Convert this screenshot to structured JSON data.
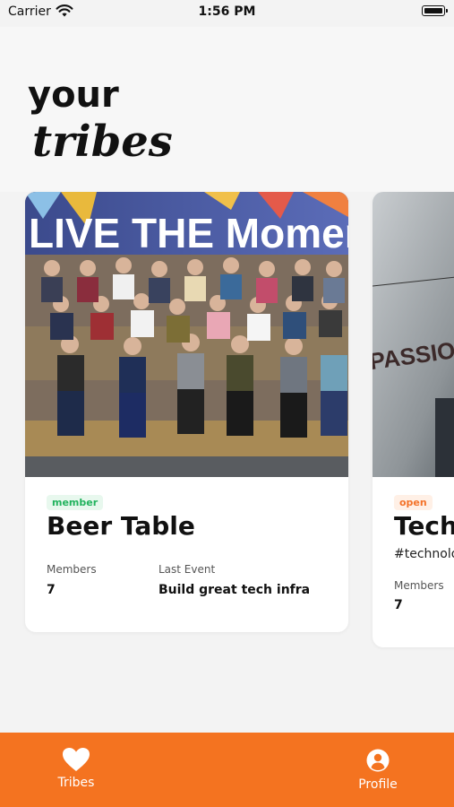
{
  "status_bar": {
    "carrier": "Carrier",
    "time": "1:56 PM"
  },
  "header": {
    "title_line1": "your",
    "title_line2": "tribes"
  },
  "tribes": [
    {
      "badge": "member",
      "badge_color": "#22b35e",
      "name": "Beer Table",
      "tag": "",
      "photo_text": "LIVE THE Moment",
      "stats": [
        {
          "label": "Members",
          "value": "7"
        },
        {
          "label": "Last Event",
          "value": "Build great tech infra"
        }
      ]
    },
    {
      "badge": "open",
      "badge_color": "#f4732a",
      "name": "Tech",
      "tag": "#technolo",
      "photo_text": "PASSIO",
      "stats": [
        {
          "label": "Members",
          "value": "7"
        }
      ]
    }
  ],
  "tab_bar": {
    "accent": "#f47320",
    "tabs": [
      {
        "label": "Tribes",
        "icon": "heart-icon"
      },
      {
        "label": "Profile",
        "icon": "person-circle-icon"
      }
    ]
  }
}
